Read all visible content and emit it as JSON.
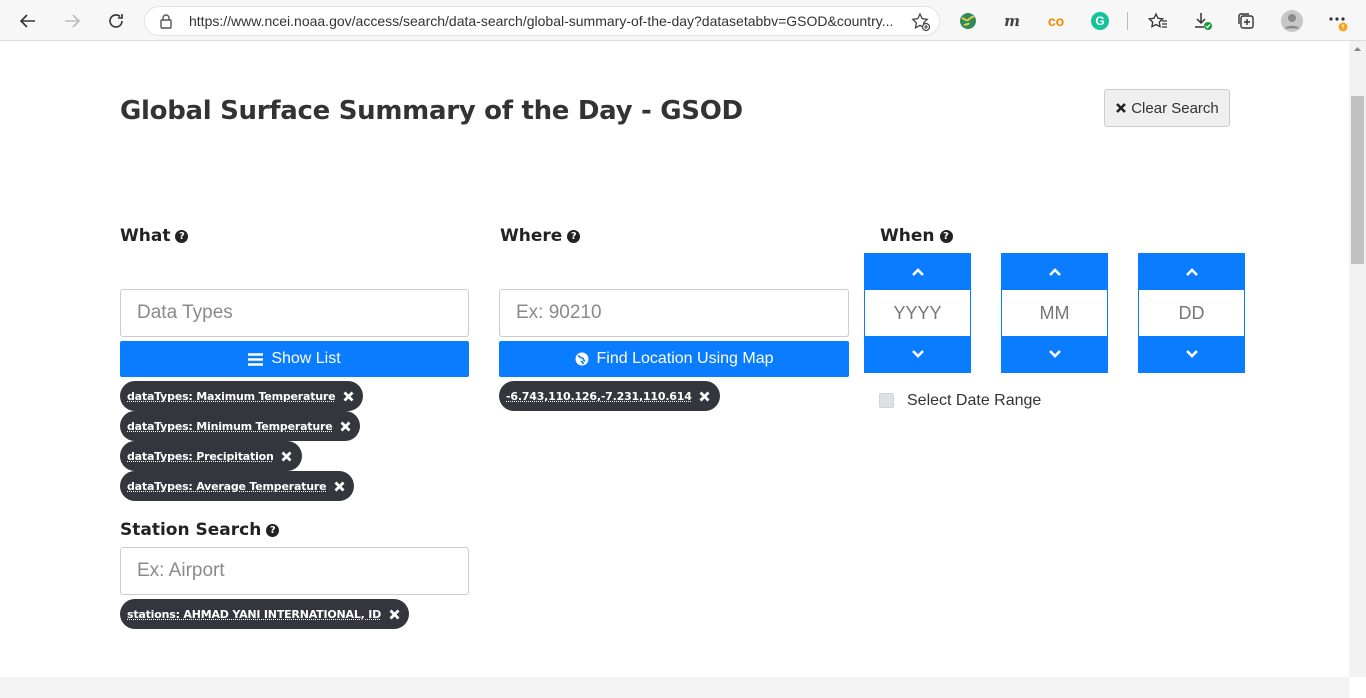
{
  "browser": {
    "url": "https://www.ncei.noaa.gov/access/search/data-search/global-summary-of-the-day?datasetabbv=GSOD&country...",
    "ext_m_label": "m",
    "ext_co_label": "co",
    "ext_g_label": "G"
  },
  "page": {
    "title": "Global Surface Summary of the Day - GSOD",
    "clear_search_label": "Clear Search"
  },
  "what": {
    "label": "What",
    "placeholder": "Data Types",
    "show_list_label": "Show List",
    "chips": [
      "dataTypes: Maximum Temperature",
      "dataTypes: Minimum Temperature",
      "dataTypes: Precipitation",
      "dataTypes: Average Temperature"
    ]
  },
  "where": {
    "label": "Where",
    "placeholder": "Ex: 90210",
    "find_location_label": "Find Location Using Map",
    "chip": "-6.743,110.126,-7.231,110.614"
  },
  "when": {
    "label": "When",
    "year_placeholder": "YYYY",
    "month_placeholder": "MM",
    "day_placeholder": "DD",
    "date_range_label": "Select Date Range"
  },
  "station": {
    "label": "Station Search",
    "placeholder": "Ex: Airport",
    "chip": "stations: AHMAD YANI INTERNATIONAL, ID"
  },
  "colors": {
    "primary": "#0a7cff",
    "chip_bg": "#33373d"
  }
}
